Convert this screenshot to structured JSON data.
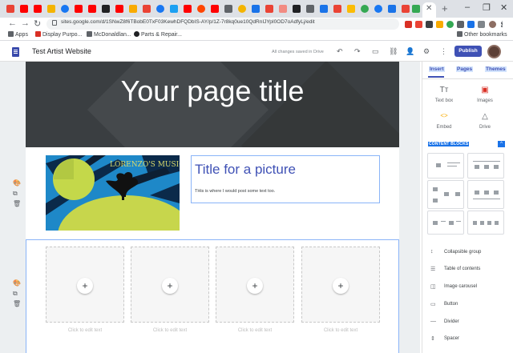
{
  "browser": {
    "tab_close_glyph": "✕",
    "new_tab_glyph": "+",
    "window_controls": [
      "–",
      "❐",
      "✕"
    ],
    "nav": {
      "back": "←",
      "forward": "→",
      "reload": "↻"
    },
    "url": "sites.google.com/d/1SNwZ8f6TBobE0TxF03KewhDFQDbIS-AY/p/1Z-7r8kq0ue10QdRnIJYpI0OD7oAdfyLj/edit",
    "bookmarks": [
      {
        "label": "Apps",
        "color": "#5f6368"
      },
      {
        "label": "Display Purpo...",
        "color": "#d93025"
      },
      {
        "label": "McDonaldlan...",
        "color": "#5f6368"
      },
      {
        "label": "Parts & Repair...",
        "color": "#202124"
      }
    ],
    "other_bookmarks": "Other bookmarks"
  },
  "sites_header": {
    "title": "Test Artist Website",
    "saved_status": "All changes saved in Drive",
    "icons": [
      "undo-icon",
      "redo-icon",
      "preview-icon",
      "link-icon",
      "share-icon",
      "settings-icon",
      "more-icon"
    ],
    "icon_glyphs": [
      "↶",
      "↷",
      "▭",
      "⛓",
      "👤",
      "⚙",
      "⋮"
    ],
    "publish_label": "Publish"
  },
  "page": {
    "hero_title": "Your page title",
    "picture_text": "LORENZO'S MUSIC",
    "title_for_picture": "Title for a picture",
    "body_text": "THis is where I would post some text too.",
    "placeholder_plus": "+",
    "placeholder_caption": "Click to edit text",
    "placeholders": 4,
    "side_tool_glyphs": [
      "🎨",
      "⧉",
      "🗑"
    ]
  },
  "panel": {
    "tabs": [
      "Insert",
      "Pages",
      "Themes"
    ],
    "insert_items": [
      {
        "label": "Text box",
        "glyph": "Tт",
        "icon": "text-box-icon",
        "color": "#5f6368"
      },
      {
        "label": "Images",
        "glyph": "▣",
        "icon": "images-icon",
        "color": "#d93025"
      },
      {
        "label": "Embed",
        "glyph": "<>",
        "icon": "embed-icon",
        "color": "#f9ab00"
      },
      {
        "label": "Drive",
        "glyph": "△",
        "icon": "drive-icon",
        "color": "#5f6368"
      }
    ],
    "content_blocks_label": "CONTENT BLOCKS",
    "collapse_glyph": "^",
    "components": [
      {
        "label": "Collapsible group",
        "glyph": "↕",
        "icon": "collapsible-group-icon"
      },
      {
        "label": "Table of contents",
        "glyph": "☰",
        "icon": "table-of-contents-icon"
      },
      {
        "label": "Image carousel",
        "glyph": "◫",
        "icon": "image-carousel-icon"
      },
      {
        "label": "Button",
        "glyph": "▭",
        "icon": "button-icon"
      },
      {
        "label": "Divider",
        "glyph": "—",
        "icon": "divider-icon"
      },
      {
        "label": "Spacer",
        "glyph": "⇕",
        "icon": "spacer-icon"
      }
    ]
  }
}
